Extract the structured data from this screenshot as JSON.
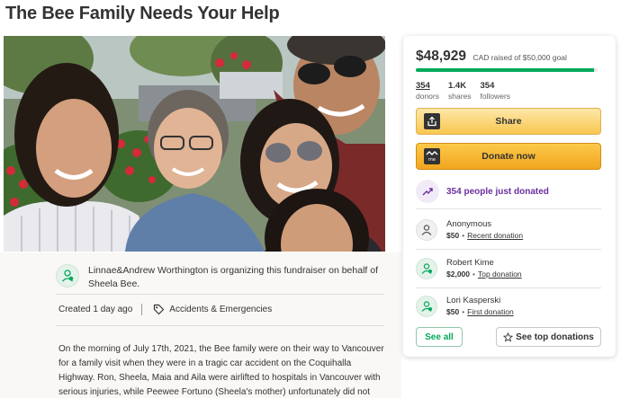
{
  "page": {
    "title": "The Bee Family Needs Your Help"
  },
  "hero": {
    "image": "family-selfie-photo"
  },
  "organizer": {
    "icon": "organizer-icon",
    "text": "Linnae&Andrew Worthington is organizing this fundraiser on behalf of Sheela Bee."
  },
  "meta": {
    "created": "Created 1 day ago",
    "category_icon": "tag-icon",
    "category": "Accidents & Emergencies"
  },
  "story": {
    "text": "On the morning of July 17th, 2021, the Bee family were on their way to Vancouver for a family visit when they were in a tragic car accident on the Coquihalla Highway. Ron, Sheela, Maia and Aila were airlifted to hospitals in Vancouver with serious injuries, while Peewee Fortuno (Sheela's mother) unfortunately did not survive the crash."
  },
  "summary": {
    "raised": "$48,929",
    "raised_text": "CAD raised of $50,000 goal",
    "progress_fraction": 0.979,
    "stats": [
      {
        "value": "354",
        "label": "donors"
      },
      {
        "value": "1.4K",
        "label": "shares"
      },
      {
        "value": "354",
        "label": "followers"
      }
    ]
  },
  "actions": {
    "share_label": "Share",
    "share_icon": "share-icon",
    "donate_label": "Donate now",
    "donate_icon": "gofundme-logo-icon"
  },
  "just_donated": {
    "icon": "trending-up-icon",
    "text": "354 people just donated"
  },
  "donations": [
    {
      "name": "Anonymous",
      "amount": "$50",
      "kind": "Recent donation",
      "icon": "user-icon"
    },
    {
      "name": "Robert Kime",
      "amount": "$2,000",
      "kind": "Top donation",
      "icon": "donor-icon"
    },
    {
      "name": "Lori Kasperski",
      "amount": "$50",
      "kind": "First donation",
      "icon": "donor-icon"
    }
  ],
  "footer_buttons": {
    "see_all": "See all",
    "see_top": "See top donations",
    "see_top_icon": "star-icon"
  },
  "colors": {
    "brand_green": "#02a95c",
    "accent_purple": "#6b2fa0",
    "button_yellow": "#f9c74f",
    "button_orange": "#f2a51f",
    "text": "#333333"
  }
}
